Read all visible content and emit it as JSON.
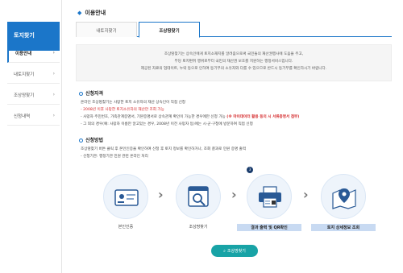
{
  "sidebar": {
    "title": "토지찾기",
    "items": [
      {
        "label": "이용안내",
        "arrow": "›"
      },
      {
        "label": "내토지찾기",
        "arrow": "›"
      },
      {
        "label": "조상땅찾기",
        "arrow": "›"
      },
      {
        "label": "신청내역",
        "arrow": "›"
      }
    ]
  },
  "page": {
    "title_mark": "◆",
    "title": "이용안내"
  },
  "tabs": [
    {
      "label": "내토지찾기"
    },
    {
      "label": "조상땅찾기"
    }
  ],
  "intro": {
    "lines": [
      "조상땅찾기는 상속인에게 토지소재지를 알려줌으로써 국민들의 재산권행사에 도움을 주고,",
      "부당 토지편취 행위로부터 국민의 재산권 보호를 지원하는 행정서비스입니다.",
      "제공된 자료의 업데이트, 누락 등으로 인하여 등기부의 소유자와 다를 수 있으므로 반드시 등기부를 확인하시기 바랍니다."
    ]
  },
  "section1": {
    "heading": "신청자격",
    "lines": [
      {
        "text": "온라인 조상땅찾기는 사망한 토지 소유자의 재산 상속인이 직접 신청",
        "style": "normal"
      },
      {
        "text": "- 2008년 이후 사망한 토지소유자의 재산만 조회 가능",
        "style": "red"
      },
      {
        "text": "- 사망자 주민번호, 가족관계증명서, 기본증명서로 상속관계 확인이 가능한 경우에만 신청 가능",
        "style": "normal",
        "tail": "(※ 마이데이터 활용 동의 시 서류증명서 첨부)",
        "tail_style": "red-bold"
      },
      {
        "text": "- 그 외의 경우(예: 사망자 이름만 알고있는 경우, 2008년 이전 사망자 등)에는 시·군·구청에 방문하여 직접 신청",
        "style": "normal"
      }
    ]
  },
  "section2": {
    "heading": "신청방법",
    "lines": [
      {
        "text": "조상땅찾기 버튼 클릭 후 본인인증을 확인하여 신청 후 토지 정보를 확인하거나, 조회 결과로 민원 증명 출력",
        "style": "normal"
      },
      {
        "text": "- 신청기관: 행정기관 민원 관련 온라인 처리",
        "style": "normal"
      }
    ]
  },
  "flow": {
    "steps": [
      {
        "label": "본인인증",
        "icon": "id-card-icon",
        "highlight": false
      },
      {
        "label": "조상땅찾기",
        "icon": "search-document-icon",
        "highlight": false
      },
      {
        "label": "결과 출력 및 QR확인",
        "icon": "printer-icon",
        "highlight": true,
        "badge": "3"
      },
      {
        "label": "토지 상세정보 조회",
        "icon": "map-pin-icon",
        "highlight": true
      }
    ],
    "chevron": "›"
  },
  "button": {
    "label": "조상땅찾기",
    "icon": "search-icon"
  },
  "colors": {
    "primary": "#1b76c9",
    "accent_red": "#d4282a",
    "button_teal": "#18a3a6",
    "step_bg": "#eef4fb"
  }
}
